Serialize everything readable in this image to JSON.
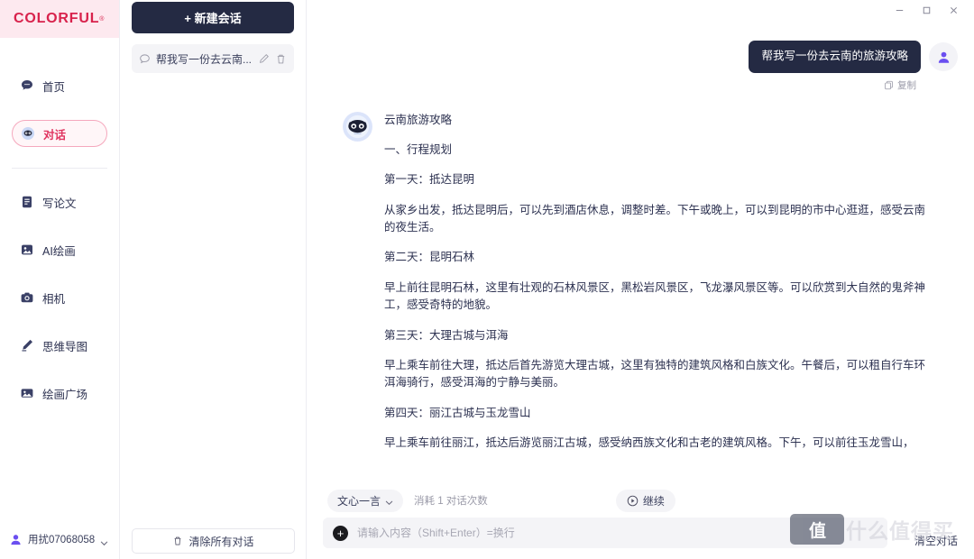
{
  "brand": {
    "name": "COLORFUL",
    "registered": "®"
  },
  "window_controls": [
    {
      "name": "minimize",
      "glyph": "—"
    },
    {
      "name": "maximize",
      "glyph": "☐"
    },
    {
      "name": "close",
      "glyph": "✕"
    }
  ],
  "sidebar": {
    "items": [
      {
        "label": "首页",
        "icon": "chat-bubble-icon",
        "active": false
      },
      {
        "label": "对话",
        "icon": "robot-icon",
        "active": true
      },
      {
        "label": "写论文",
        "icon": "document-icon",
        "active": false
      },
      {
        "label": "AI绘画",
        "icon": "image-icon",
        "active": false
      },
      {
        "label": "相机",
        "icon": "camera-icon",
        "active": false
      },
      {
        "label": "思维导图",
        "icon": "pencil-icon",
        "active": false
      },
      {
        "label": "绘画广场",
        "icon": "gallery-icon",
        "active": false
      }
    ],
    "user": {
      "name": "用扰07068058",
      "icon": "person-icon",
      "chevron": "chevron-down-icon"
    }
  },
  "conversations": {
    "new_chat_label": "+ 新建会话",
    "items": [
      {
        "title": "帮我写一份去云南...",
        "icon": "chat-bubble-icon",
        "edit_icon": "pencil-icon",
        "delete_icon": "trash-icon"
      }
    ],
    "clear_all_label": "清除所有对话",
    "clear_all_icon": "trash-icon"
  },
  "chat": {
    "user_message": "帮我写一份去云南的旅游攻略",
    "copy_label": "复制",
    "copy_icon": "copy-icon",
    "bot_avatar_icon": "robot-avatar-icon",
    "user_avatar_icon": "person-icon",
    "bot_paragraphs": [
      "云南旅游攻略",
      "一、行程规划",
      "第一天：抵达昆明",
      "从家乡出发，抵达昆明后，可以先到酒店休息，调整时差。下午或晚上，可以到昆明的市中心逛逛，感受云南的夜生活。",
      "第二天：昆明石林",
      "早上前往昆明石林，这里有壮观的石林风景区，黑松岩风景区，飞龙瀑风景区等。可以欣赏到大自然的鬼斧神工，感受奇特的地貌。",
      "第三天：大理古城与洱海",
      "早上乘车前往大理，抵达后首先游览大理古城，这里有独特的建筑风格和白族文化。午餐后，可以租自行车环洱海骑行，感受洱海的宁静与美丽。",
      "第四天：丽江古城与玉龙雪山",
      "早上乘车前往丽江，抵达后游览丽江古城，感受纳西族文化和古老的建筑风格。下午，可以前往玉龙雪山，"
    ]
  },
  "footer": {
    "model_label": "文心一言",
    "model_chevron": "chevron-down-icon",
    "consume_text": "消耗 1 对话次数",
    "continue_label": "继续",
    "continue_icon": "play-circle-icon",
    "plus_icon": "plus-icon",
    "input_value": "",
    "input_placeholder": "请输入内容（Shift+Enter）=换行",
    "clear_conv_label": "清空对话"
  },
  "watermark": {
    "badge": "值",
    "text": "什么值得买"
  },
  "colors": {
    "brand_pink_bg": "#fde9ef",
    "brand_red": "#d8224c",
    "accent_active": "#e03560",
    "dark_navy": "#242a43",
    "panel_gray": "#f4f4f7",
    "purple": "#6b4ff0"
  }
}
